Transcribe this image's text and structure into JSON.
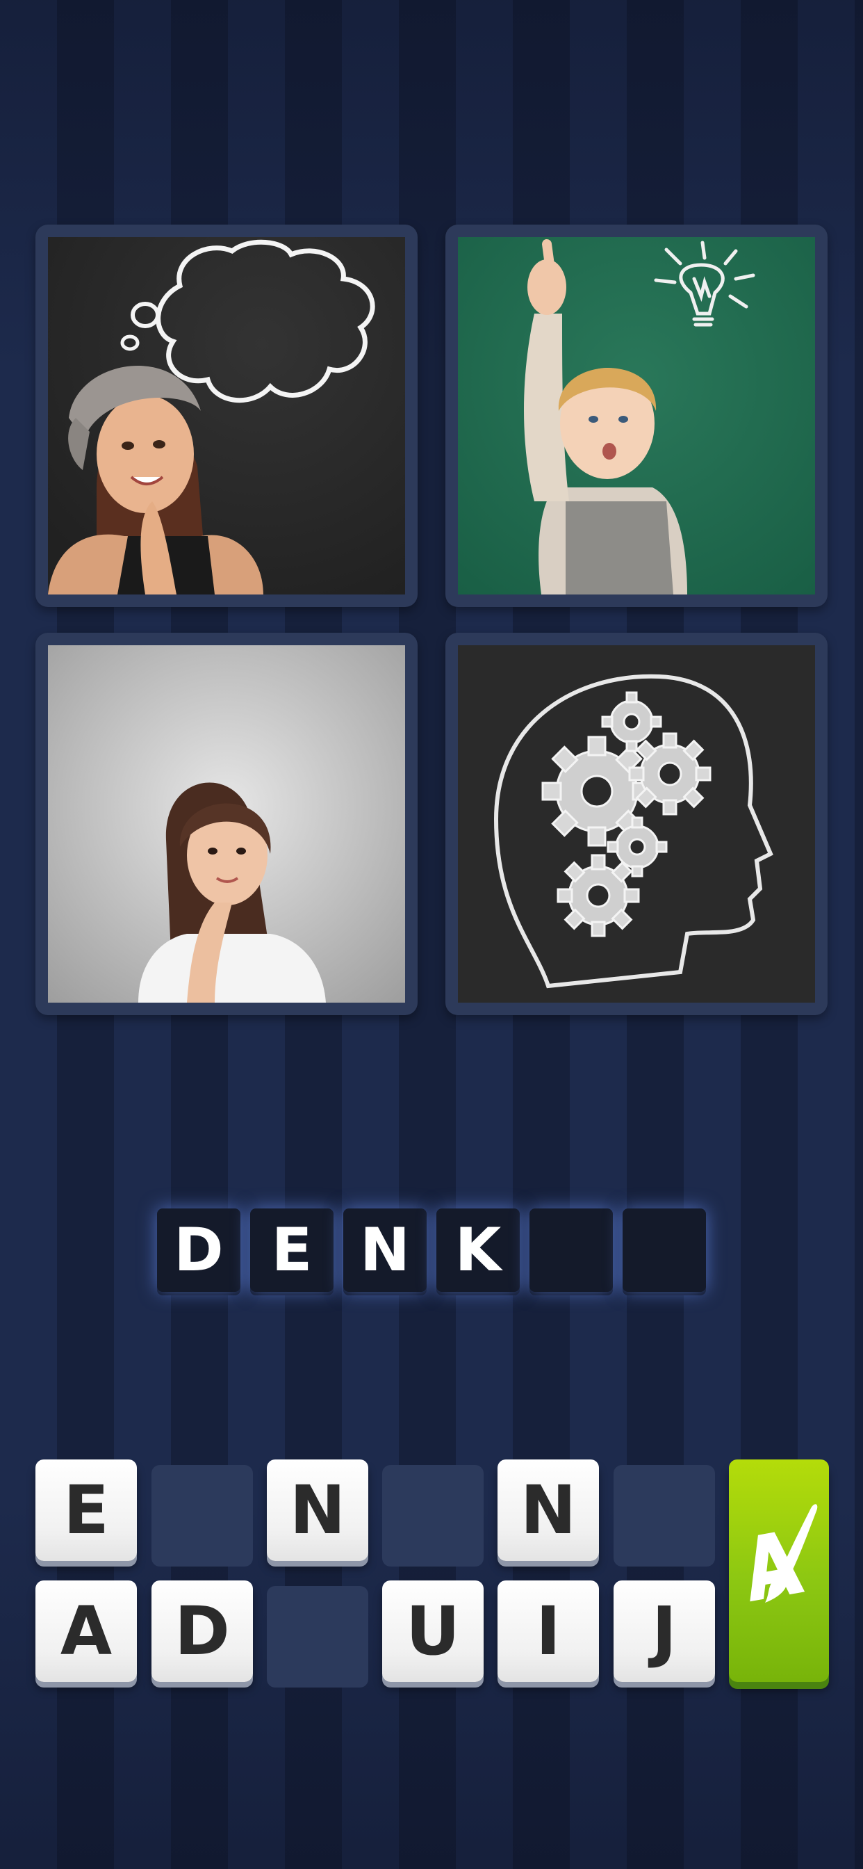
{
  "puzzle": {
    "pictures": [
      {
        "description_icon": "woman-thought-bubble-image"
      },
      {
        "description_icon": "boy-lightbulb-image"
      },
      {
        "description_icon": "woman-pondering-image"
      },
      {
        "description_icon": "head-gears-image"
      }
    ]
  },
  "answer": {
    "slots": [
      "D",
      "E",
      "N",
      "K",
      "",
      ""
    ]
  },
  "letters": {
    "row1": [
      "E",
      "",
      "N",
      "",
      "N",
      ""
    ],
    "row2": [
      "A",
      "D",
      "",
      "U",
      "I",
      "J"
    ]
  },
  "hint": {
    "icon": "paintbrush-letter-a-icon",
    "color": "#8cc712"
  },
  "colors": {
    "background": "#1a2544",
    "frame": "#2d3a5a",
    "slot": "#141a2a",
    "slot_glow": "#6e96ff"
  }
}
